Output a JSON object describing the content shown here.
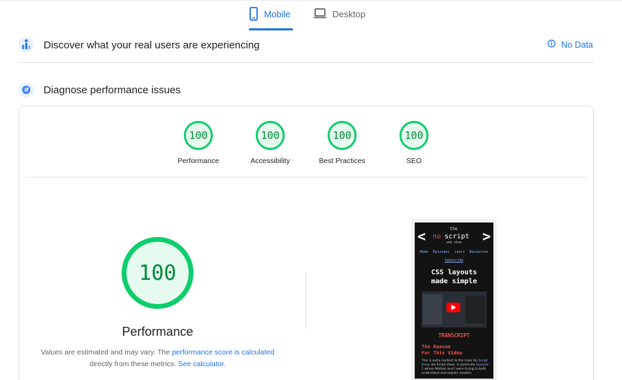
{
  "tabs": {
    "mobile": "Mobile",
    "desktop": "Desktop"
  },
  "field": {
    "title": "Discover what your real users are experiencing",
    "status": "No Data"
  },
  "lab": {
    "title": "Diagnose performance issues"
  },
  "categories": [
    {
      "label": "Performance",
      "score": "100"
    },
    {
      "label": "Accessibility",
      "score": "100"
    },
    {
      "label": "Best Practices",
      "score": "100"
    },
    {
      "label": "SEO",
      "score": "100"
    }
  ],
  "main_score": {
    "score": "100",
    "title": "Performance",
    "note_prefix": "Values are estimated and may vary. The ",
    "note_link1": "performance score is calculated",
    "note_mid": " directly from these metrics. ",
    "note_link2": "See calculator."
  },
  "screenshot": {
    "logo_the": "the",
    "logo_no": "no",
    "logo_script": "script",
    "logo_web": "web show",
    "nav": [
      "Home",
      "Episodes",
      "Learn",
      "Resources"
    ],
    "subscribe": "Subscribe",
    "headline_1": "CSS layouts",
    "headline_2": "made simple",
    "transcript": "TRANSCRIPT",
    "reason_1": "The Reason",
    "reason_2": "For This Video",
    "body_1": "This is extra content to the main ",
    "body_link1": "No Script show",
    "body_2": ". No Script show, in particular ",
    "body_link2": "Episode 1",
    "body_3": " where Nathan and I were trying to both understand and explain modern"
  },
  "colors": {
    "accent": "#1a73e8",
    "pass": "#0cce6b",
    "pass_text": "#008a3a"
  }
}
